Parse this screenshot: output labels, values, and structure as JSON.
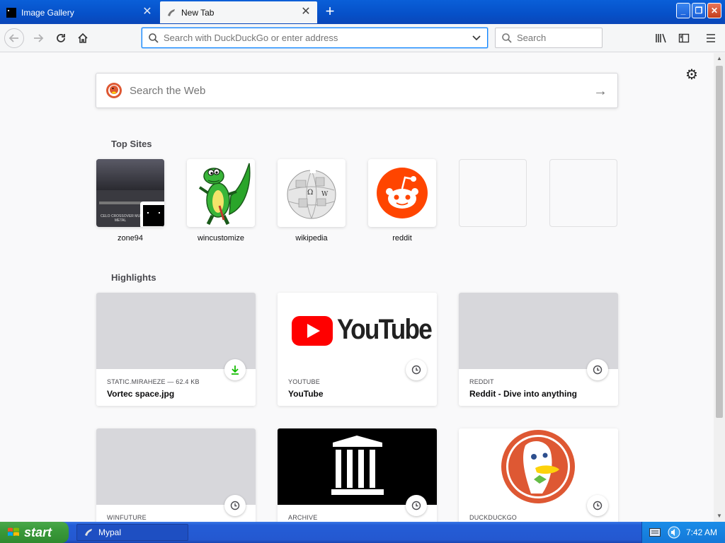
{
  "tabs": [
    {
      "title": "Image Gallery",
      "active": false,
      "icon": "black-square-icon"
    },
    {
      "title": "New Tab",
      "active": true,
      "icon": "lizard-icon"
    }
  ],
  "navbar": {
    "url_placeholder": "Search with DuckDuckGo or enter address",
    "search_placeholder": "Search"
  },
  "newtab": {
    "websearch_placeholder": "Search the Web",
    "topsites_title": "Top Sites",
    "highlights_title": "Highlights",
    "topsites": [
      {
        "label": "zone94"
      },
      {
        "label": "wincustomize"
      },
      {
        "label": "wikipedia"
      },
      {
        "label": "reddit"
      },
      {
        "label": ""
      },
      {
        "label": ""
      }
    ],
    "zone94_thumb_text": "CELO CROSSOVER MU METAL",
    "highlights": [
      {
        "source": "STATIC.MIRAHEZE — 62.4 KB",
        "title": "Vortec space.jpg",
        "badge": "download-icon"
      },
      {
        "source": "YOUTUBE",
        "title": "YouTube",
        "badge": "clock-icon",
        "logo_text": "YouTube"
      },
      {
        "source": "REDDIT",
        "title": "Reddit - Dive into anything",
        "badge": "clock-icon"
      },
      {
        "source": "WINFUTURE",
        "title": "",
        "badge": "clock-icon"
      },
      {
        "source": "ARCHIVE",
        "title": "",
        "badge": "clock-icon"
      },
      {
        "source": "DUCKDUCKGO",
        "title": "",
        "badge": "clock-icon"
      }
    ]
  },
  "taskbar": {
    "start_label": "start",
    "task_label": "Mypal",
    "clock": "7:42 AM"
  },
  "colors": {
    "accent": "#0a84ff",
    "download_green": "#12bc00",
    "reddit_orange": "#ff4500",
    "youtube_red": "#ff0000",
    "ddg_orange": "#de5833"
  }
}
